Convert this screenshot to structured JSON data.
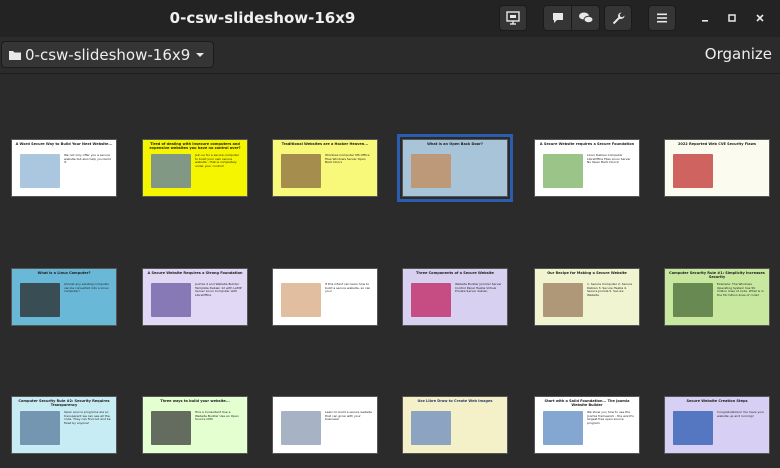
{
  "window": {
    "title": "0-csw-slideshow-16x9"
  },
  "toolbar": {
    "folder_label": "0-csw-slideshow-16x9",
    "organize_label": "Organize"
  },
  "slides": [
    {
      "title": "A Word Secure Way to Build Your Next Website...",
      "body": "We not only offer you a secure website but also help you build it.",
      "bg": "#ffffff",
      "fg": "#1a1a1a",
      "accent": "#8fb4d6"
    },
    {
      "title": "Tired of dealing with insecure computers and expensive websites you have no control over?",
      "body": "Join us for a secure computer to build your own secure website - that is completely under your control!",
      "bg": "#f5f500",
      "fg": "#1a1a1a",
      "accent": "#5a7ab0"
    },
    {
      "title": "Traditional Websites are a Hacker Heaven...",
      "body": "Windows Computer   MS Office Files   Windows Server   Open Back Doors",
      "bg": "#f8f87a",
      "fg": "#1a1a1a",
      "accent": "#8a6a40"
    },
    {
      "title": "What is an Open Back Door?",
      "body": "",
      "bg": "#a8c4d8",
      "fg": "#1a1a1a",
      "accent": "#c48a5a"
    },
    {
      "title": "A Secure Website requires a Secure Foundation",
      "body": "Linux Debian Computer   LibreOffice Files   Linux Server   No Open Back Doors!",
      "bg": "#ffffff",
      "fg": "#1a1a1a",
      "accent": "#7ab060"
    },
    {
      "title": "2022 Reported Web CVE Security Flaws",
      "body": "",
      "bg": "#fbfbf0",
      "fg": "#1a1a1a",
      "accent": "#c03030"
    },
    {
      "title": "What is a Linux Computer?",
      "body": "Almost any existing computer can be converted into a Linux computer!",
      "bg": "#6ab8d8",
      "fg": "#1a1a1a",
      "accent": "#2a2a2a"
    },
    {
      "title": "A Secure Website Requires a Strong Foundation",
      "body": "Joomla 4 and Website Builder Template   Debian 12 with LAMP Server   Linux Computer with LibreOffice",
      "bg": "#e0d8f4",
      "fg": "#1a1a1a",
      "accent": "#6a5aa0"
    },
    {
      "title": "",
      "body": "If this infant can learn how to build a secure website, so can you!",
      "bg": "#ffffff",
      "fg": "#1a1a1a",
      "accent": "#d8a880"
    },
    {
      "title": "Three Components of a Secure Website",
      "body": "Website Builder   Joomla!   Server Control Panel   Hestia   Virtual Private Server   debian",
      "bg": "#d8d0f0",
      "fg": "#1a1a1a",
      "accent": "#c02060"
    },
    {
      "title": "Our Recipe for Making a Secure Website",
      "body": "1. Secure Computer 2. Secure Debian 3. Secure Hestia 4. Secure Joomla 5. Secure Website",
      "bg": "#f0f4d0",
      "fg": "#1a1a1a",
      "accent": "#9a7a5a"
    },
    {
      "title": "Computer Security Rule #1: Simplicity Increases Security",
      "body": "Example: The Windows Operating System has 50 million lines of code. What is in the 50 million lines of code?",
      "bg": "#c8e8a0",
      "fg": "#1a1a1a",
      "accent": "#4a6a3a"
    },
    {
      "title": "Computer Security Rule #2: Security Requires Transparency",
      "body": "Open source programs are so transparent we can see all the code. They can find out and be fixed by anyone!",
      "bg": "#c8ecf4",
      "fg": "#1a1a1a",
      "accent": "#5a7a9a"
    },
    {
      "title": "Three ways to build your website...",
      "body": "Hire a Consultant   Use a Website Builder   Use an Open Source CMS",
      "bg": "#e4ffd0",
      "fg": "#1a1a1a",
      "accent": "#3a3a3a"
    },
    {
      "title": "",
      "body": "Learn to build a secure website that can grow with your business!",
      "bg": "#ffffff",
      "fg": "#1a1a1a",
      "accent": "#8a9ab0"
    },
    {
      "title": "Use Libre Draw to Create Web Images",
      "body": "",
      "bg": "#f4f0c8",
      "fg": "#2a3a6a",
      "accent": "#6a8ac0"
    },
    {
      "title": "Start with a Solid Foundation... The Joomla Website Builder",
      "body": "We show you how to use the Joomla framework - the world's largest free open source program",
      "bg": "#ffffff",
      "fg": "#1a1a1a",
      "accent": "#5a8ac0"
    },
    {
      "title": "Secure Website Creation Steps",
      "body": "Congratulations! You have your website up and running!",
      "bg": "#d8d0f4",
      "fg": "#1a1a1a",
      "accent": "#2a5ab0"
    }
  ]
}
